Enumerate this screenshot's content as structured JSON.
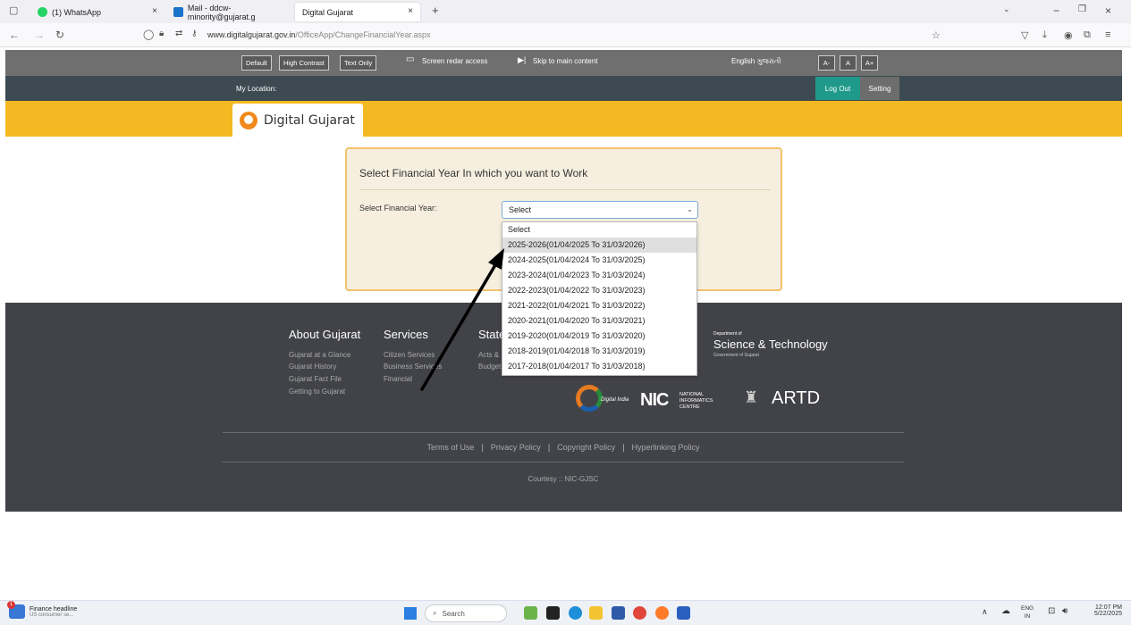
{
  "browser": {
    "tabs": [
      {
        "label": "(1) WhatsApp"
      },
      {
        "label": "Mail - ddcw-minority@gujarat.g"
      },
      {
        "label": "Digital Gujarat"
      }
    ],
    "new_tab": "+",
    "url_domain": "www.digitalgujarat.gov.in",
    "url_path": "/OfficeApp/ChangeFinancialYear.aspx"
  },
  "accessibility": {
    "default_label": "Default",
    "high_contrast_label": "High Contrast",
    "text_only_label": "Text Only",
    "screen_reader_label": "Screen redar access",
    "skip_label": "Skip to main content",
    "language_label": "English ગુજરાતી",
    "font_small": "A-",
    "font_normal": "A",
    "font_large": "A+"
  },
  "location": {
    "label": "My Location:",
    "logout_label": "Log Out",
    "setting_label": "Setting"
  },
  "brand": {
    "name": "Digital Gujarat"
  },
  "form": {
    "title": "Select Financial Year In which you want to Work",
    "field_label": "Select Financial Year:",
    "selected": "Select",
    "options": [
      "Select",
      "2025-2026(01/04/2025 To 31/03/2026)",
      "2024-2025(01/04/2024 To 31/03/2025)",
      "2023-2024(01/04/2023 To 31/03/2024)",
      "2022-2023(01/04/2022 To 31/03/2023)",
      "2021-2022(01/04/2021 To 31/03/2022)",
      "2020-2021(01/04/2020 To 31/03/2021)",
      "2019-2020(01/04/2019 To 31/03/2020)",
      "2018-2019(01/04/2018 To 31/03/2019)",
      "2017-2018(01/04/2017 To 31/03/2018)"
    ],
    "highlighted_option": "2025-2026(01/04/2025 To 31/03/2026)"
  },
  "footer": {
    "about_title": "About Gujarat",
    "about_links": [
      "Gujarat at a Glance",
      "Gujarat History",
      "Gujarat Fact File",
      "Getting to Gujarat"
    ],
    "services_title": "Services",
    "services_links": [
      "Citizen Services",
      "Business Services",
      "Financial"
    ],
    "state_title": "State",
    "state_links": [
      "Acts & Rules",
      "Budget"
    ],
    "dst_line1": "Department of",
    "dst_line2": "Science & Technology",
    "dst_line3": "Government of Gujarat",
    "digital_india": "Digital India",
    "nic_text": "NIC",
    "nic_full": "NATIONAL INFORMATICS CENTRE",
    "artd": "ARTD",
    "bottom_links": [
      "Terms of Use",
      "Privacy Policy",
      "Copyright Policy",
      "Hyperlinking Policy"
    ],
    "courtesy": "Courtesy :: NIC-GJSC"
  },
  "taskbar": {
    "news_title": "Finance headline",
    "news_sub": "US consumer se...",
    "news_badge": "1",
    "search_placeholder": "Search",
    "lang": "ENG",
    "region": "IN",
    "time": "12:07 PM",
    "date": "5/22/2025"
  },
  "colors": {
    "brand_yellow": "#f4b922",
    "logout_teal": "#1f9a8a",
    "footer_bg": "#424348",
    "card_border": "#f2c36b"
  }
}
